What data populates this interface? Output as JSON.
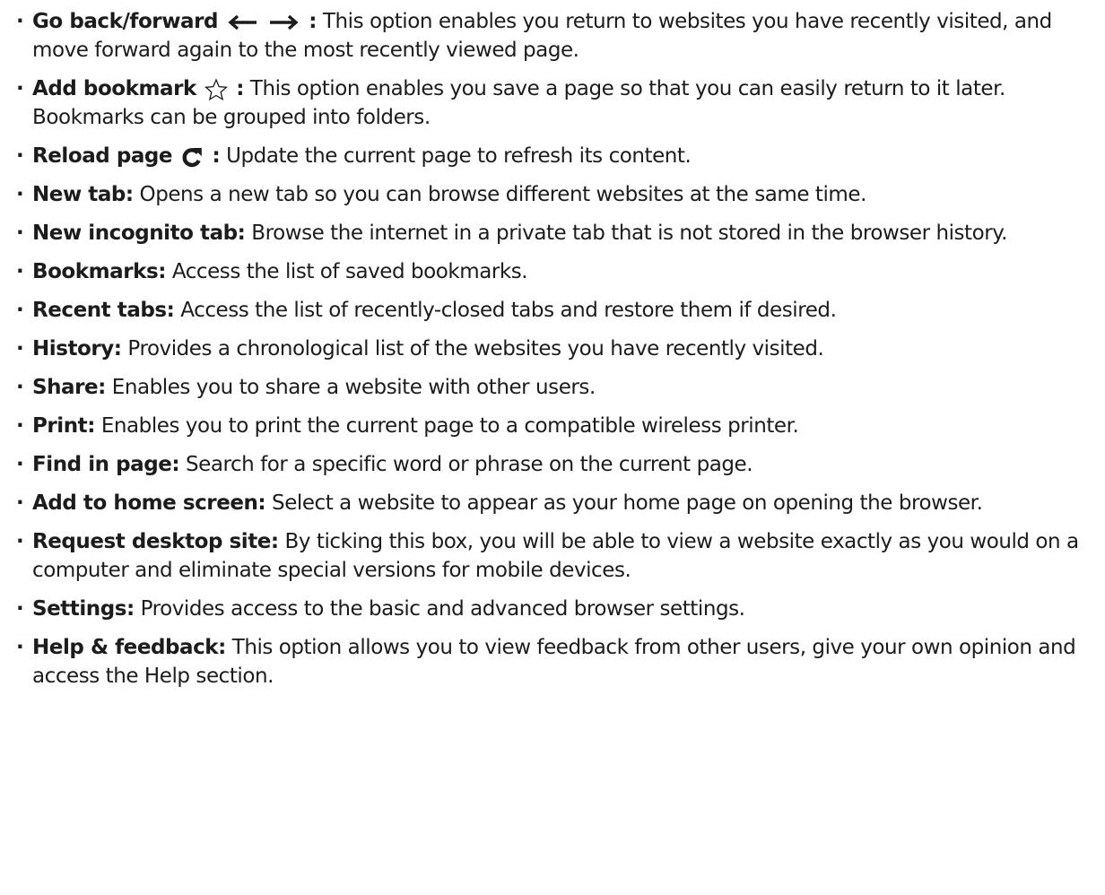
{
  "bullet": "·",
  "items": [
    {
      "term": "Go back/forward",
      "icons": [
        "back-arrow-icon",
        "forward-arrow-icon"
      ],
      "sep": " :",
      "desc": " This option enables you return to websites you have recently visited, and move forward again to the most recently viewed page."
    },
    {
      "term": "Add bookmark",
      "icons": [
        "star-outline-icon"
      ],
      "sep": " :",
      "desc": " This option enables you save a page so that you can easily return to it later. Bookmarks can be grouped into folders."
    },
    {
      "term": "Reload page",
      "icons": [
        "reload-icon"
      ],
      "sep": " :",
      "desc": " Update the current page to refresh its content."
    },
    {
      "term": "New tab:",
      "desc": " Opens a new tab so you can browse different websites at the same time."
    },
    {
      "term": "New incognito tab:",
      "desc": " Browse the internet in a private tab that is not stored in the browser history."
    },
    {
      "term": "Bookmarks:",
      "desc": " Access the list of saved bookmarks."
    },
    {
      "term": "Recent tabs:",
      "desc": " Access the list of recently-closed tabs and restore them if desired."
    },
    {
      "term": "History:",
      "desc": " Provides a chronological list of the websites you have recently visited."
    },
    {
      "term": "Share:",
      "desc": " Enables you to share a website with other users."
    },
    {
      "term": "Print:",
      "desc": " Enables you to print the current page to a compatible wireless printer."
    },
    {
      "term": "Find in page:",
      "desc": " Search for a specific word or phrase on the current page."
    },
    {
      "term": "Add to home screen:",
      "desc": " Select a website to appear as your home page on opening the browser."
    },
    {
      "term": "Request desktop site:",
      "desc": " By ticking this box, you will be able to view a website exactly as you would on a computer and eliminate special versions for mobile devices."
    },
    {
      "term": "Settings:",
      "desc": " Provides access to the basic and advanced browser settings."
    },
    {
      "term": "Help & feedback:",
      "desc": " This option allows you to view feedback from other users, give your own opinion and access the Help section."
    }
  ]
}
